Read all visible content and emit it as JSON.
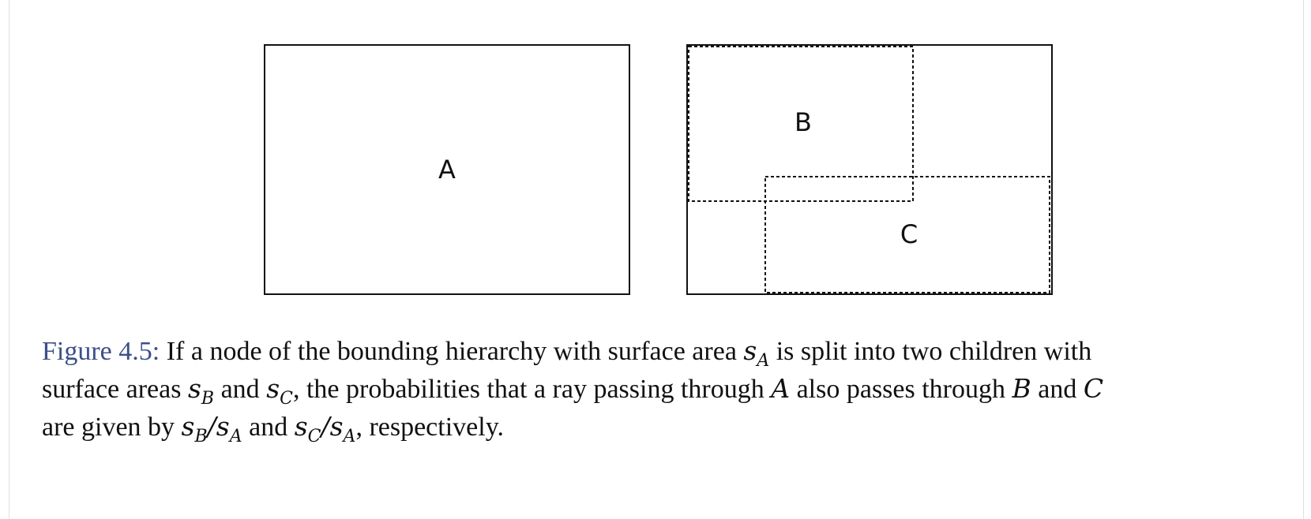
{
  "figure": {
    "box_a_label": "A",
    "box_b_label": "B",
    "box_c_label": "C"
  },
  "caption": {
    "figure_label": "Figure 4.5:",
    "line1_text1": " If a node of the bounding hierarchy with surface area ",
    "var_s": "s",
    "sub_A": "A",
    "sub_B": "B",
    "sub_C": "C",
    "line1_text2": " is split into two children with",
    "line2_text1": "surface areas ",
    "line2_and": " and ",
    "line2_text2": ", the probabilities that a ray passing through ",
    "var_A": "A",
    "line2_text3": " also passes through ",
    "var_B": "B",
    "line2_and2": " and ",
    "var_C": "C",
    "line3_text1": "are given by ",
    "slash": "/",
    "line3_and": " and ",
    "line3_text2": ", respectively."
  }
}
